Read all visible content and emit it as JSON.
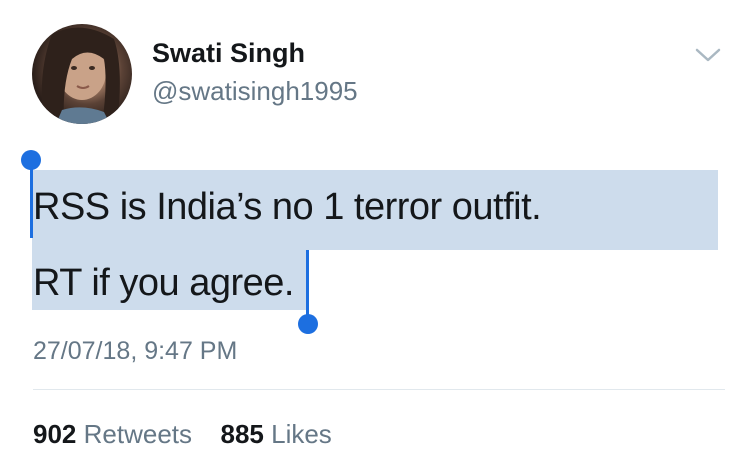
{
  "user": {
    "display_name": "Swati Singh",
    "handle": "@swatisingh1995",
    "avatar": "profile-photo"
  },
  "tweet": {
    "line1": "RSS is India’s no 1 terror outfit.",
    "line2": "RT if you agree.",
    "timestamp": "27/07/18, 9:47 PM"
  },
  "stats": {
    "retweets_count": "902",
    "retweets_label": "Retweets",
    "likes_count": "885",
    "likes_label": "Likes"
  },
  "icons": {
    "menu": "chevron-down-icon"
  },
  "colors": {
    "selection_highlight": "#cddcec",
    "selection_handle": "#1d6fe0",
    "secondary_text": "#657786",
    "primary_text": "#14171a"
  }
}
